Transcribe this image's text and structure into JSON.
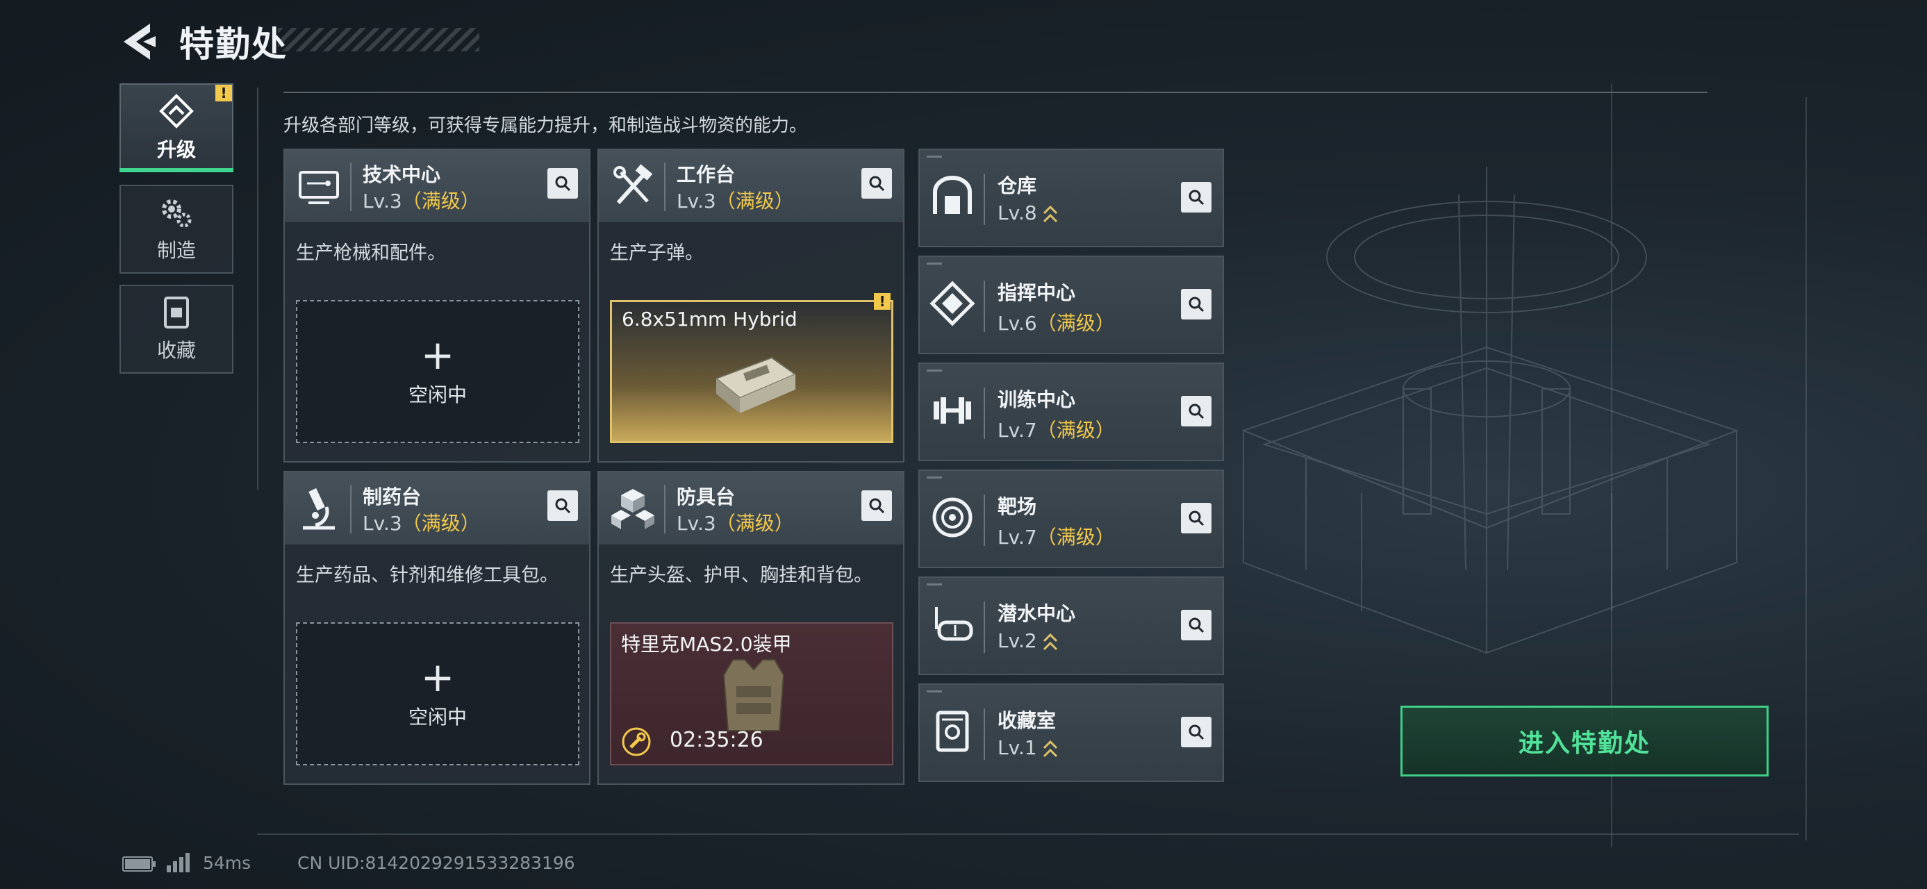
{
  "header": {
    "title": "特勤处"
  },
  "sidebar": {
    "tabs": [
      {
        "label": "升级",
        "icon": "upgrade-icon",
        "active": true,
        "badge": "!"
      },
      {
        "label": "制造",
        "icon": "gears-icon",
        "active": false
      },
      {
        "label": "收藏",
        "icon": "collection-icon",
        "active": false
      }
    ]
  },
  "description": "升级各部门等级，可获得专属能力提升，和制造战斗物资的能力。",
  "workstations": [
    {
      "name": "技术中心",
      "level": "Lv.3",
      "level_note": "（满级）",
      "desc": "生产枪械和配件。",
      "slot_text": "空闲中",
      "icon": "computer-icon"
    },
    {
      "name": "工作台",
      "level": "Lv.3",
      "level_note": "（满级）",
      "desc": "生产子弹。",
      "item_name": "6.8x51mm Hybrid",
      "badge": "!",
      "icon": "tools-icon"
    },
    {
      "name": "制药台",
      "level": "Lv.3",
      "level_note": "（满级）",
      "desc": "生产药品、针剂和维修工具包。",
      "slot_text": "空闲中",
      "icon": "microscope-icon"
    },
    {
      "name": "防具台",
      "level": "Lv.3",
      "level_note": "（满级）",
      "desc": "生产头盔、护甲、胸挂和背包。",
      "item_name": "特里克MAS2.0装甲",
      "timer": "02:35:26",
      "icon": "cubes-icon"
    }
  ],
  "facilities": [
    {
      "name": "仓库",
      "level": "Lv.8",
      "level_note": "",
      "upgradeable": true,
      "icon": "warehouse-icon"
    },
    {
      "name": "指挥中心",
      "level": "Lv.6",
      "level_note": "（满级）",
      "upgradeable": false,
      "icon": "command-icon"
    },
    {
      "name": "训练中心",
      "level": "Lv.7",
      "level_note": "（满级）",
      "upgradeable": false,
      "icon": "dumbbell-icon"
    },
    {
      "name": "靶场",
      "level": "Lv.7",
      "level_note": "（满级）",
      "upgradeable": false,
      "icon": "target-icon"
    },
    {
      "name": "潜水中心",
      "level": "Lv.2",
      "level_note": "",
      "upgradeable": true,
      "icon": "diving-mask-icon"
    },
    {
      "name": "收藏室",
      "level": "Lv.1",
      "level_note": "",
      "upgradeable": true,
      "icon": "vault-icon"
    }
  ],
  "enter_button": "进入特勤处",
  "footer": {
    "ping": "54ms",
    "uid": "CN UID:8142029291533283196"
  },
  "colors": {
    "accent_green": "#3fd68f",
    "max_level_gold": "#f2c94c",
    "item_gold": "#c8a85a",
    "item_red": "#4a2a30"
  }
}
